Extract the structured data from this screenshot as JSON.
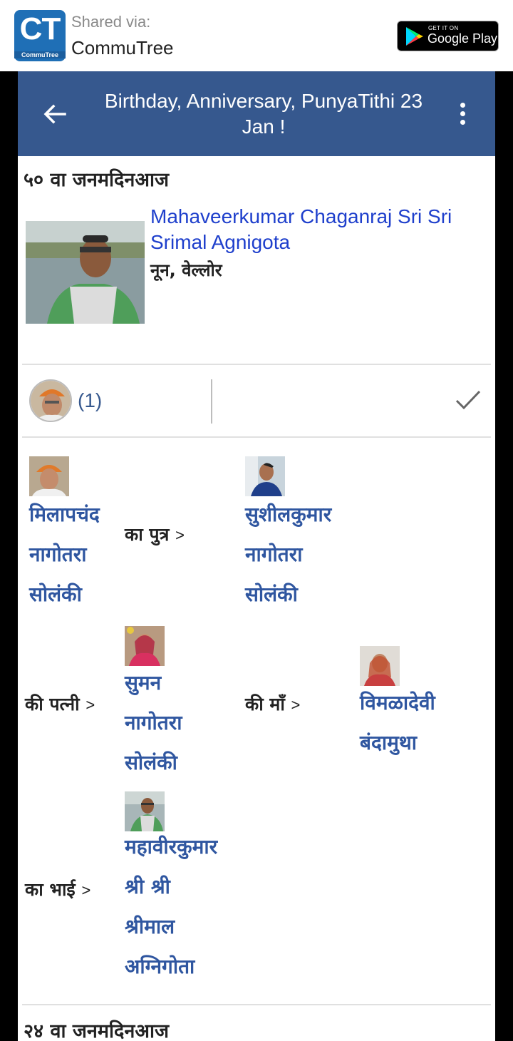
{
  "share_bar": {
    "logo_text": "CT",
    "logo_sub": "CommuTree",
    "shared_via": "Shared via:",
    "app_name": "CommuTree",
    "play_top": "GET IT ON",
    "play_main": "Google Play"
  },
  "appbar": {
    "title_line1": "Birthday, Anniversary, PunyaTithi 23",
    "title_line2": "Jan !"
  },
  "card": {
    "heading": "५० वा जनमदिनआज",
    "name_line1": "Mahaveerkumar Chaganraj Sri Sri",
    "name_line2": "Srimal Agnigota",
    "place": "नून, वेल्लोर",
    "like_count": "(1)"
  },
  "relations": {
    "r1_a": [
      "मिलापचंद",
      "नागोतरा",
      "सोलंकी"
    ],
    "r1_text": "का पुत्र",
    "r1_b": [
      "सुशीलकुमार",
      "नागोतरा",
      "सोलंकी"
    ],
    "r2_text": "की पत्नी",
    "r2_b": [
      "सुमन",
      "नागोतरा",
      "सोलंकी"
    ],
    "r3_text": "की माँ",
    "r3_b": [
      "विमळादेवी",
      "बंदामुथा"
    ],
    "r4_text": "का भाई",
    "r4_b": [
      "महावीरकुमार",
      "श्री श्री",
      "श्रीमाल",
      "अग्निगोता"
    ],
    "arrow": ">"
  },
  "next_card": {
    "heading": "२४ वा जनमदिनआज"
  },
  "colors": {
    "appbar": "#36588e",
    "link": "#1e3fcc",
    "relation_link": "#2f56a0"
  }
}
